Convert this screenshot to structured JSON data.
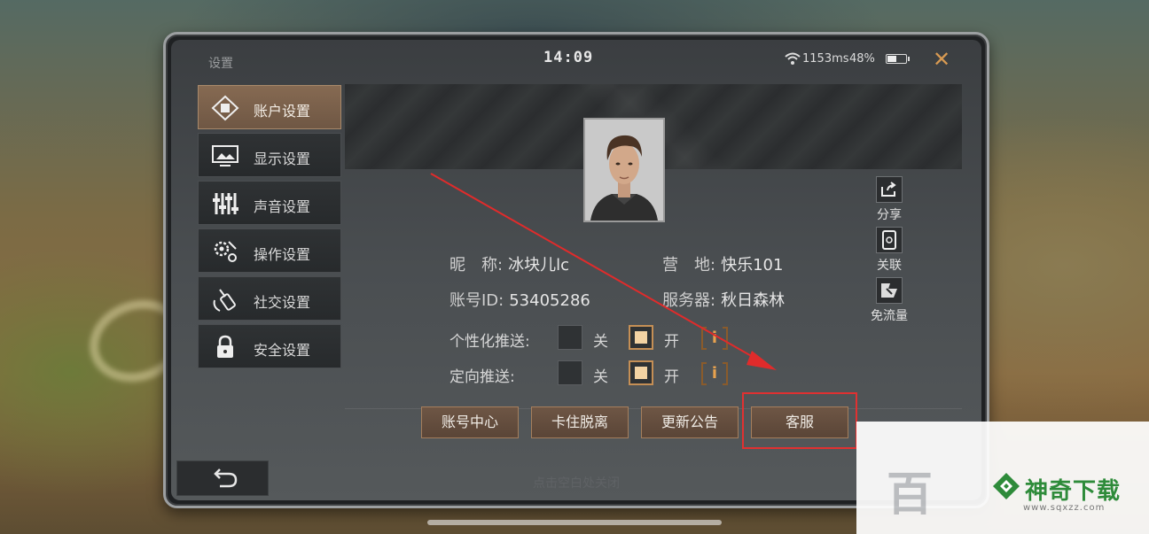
{
  "status": {
    "title": "设置",
    "time": "14:09",
    "ping": "1153ms",
    "battery": "48%",
    "battery_level": 0.48
  },
  "sidebar": {
    "items": [
      {
        "label": "账户设置",
        "icon": "account-icon",
        "active": true
      },
      {
        "label": "显示设置",
        "icon": "display-icon",
        "active": false
      },
      {
        "label": "声音设置",
        "icon": "sound-icon",
        "active": false
      },
      {
        "label": "操作设置",
        "icon": "controls-icon",
        "active": false
      },
      {
        "label": "社交设置",
        "icon": "social-icon",
        "active": false
      },
      {
        "label": "安全设置",
        "icon": "lock-icon",
        "active": false
      }
    ]
  },
  "profile": {
    "nickname_label": "昵　称:",
    "nickname": "冰块儿lc",
    "camp_label": "营　地:",
    "camp": "快乐101",
    "account_id_label": "账号ID:",
    "account_id": "53405286",
    "server_label": "服务器:",
    "server": "秋日森林"
  },
  "toggles": [
    {
      "label": "个性化推送:",
      "off": "关",
      "on": "开",
      "value": "on"
    },
    {
      "label": "定向推送:",
      "off": "关",
      "on": "开",
      "value": "on"
    }
  ],
  "side_actions": [
    {
      "label": "分享",
      "icon": "share-icon"
    },
    {
      "label": "关联",
      "icon": "link-phone-icon"
    },
    {
      "label": "免流量",
      "icon": "data-free-icon"
    }
  ],
  "buttons": {
    "account_center": "账号中心",
    "unstuck": "卡住脱离",
    "update_notice": "更新公告",
    "customer_service": "客服"
  },
  "hint": "点击空白处关闭",
  "watermark": {
    "brand": "神奇下载",
    "url": "www.sqxzz.com",
    "faded_text": "百"
  },
  "colors": {
    "accent": "#c58f55",
    "highlight": "#e03131",
    "brand_green": "#2e8b3a"
  }
}
